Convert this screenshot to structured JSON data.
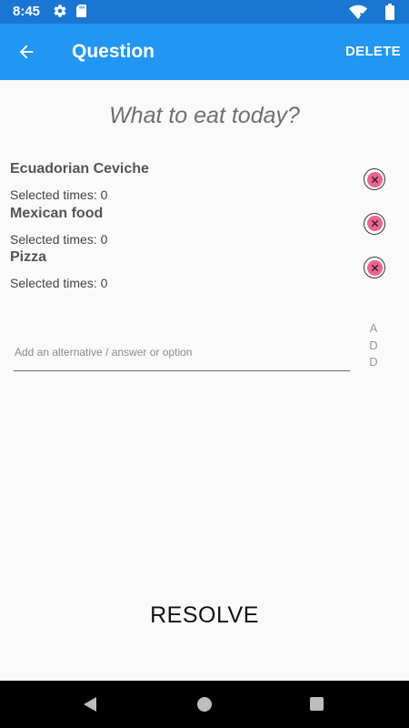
{
  "status_bar": {
    "time": "8:45",
    "icons": [
      "settings-icon",
      "sd-card-icon",
      "wifi-icon",
      "battery-icon"
    ]
  },
  "app_bar": {
    "title": "Question",
    "back_icon": "arrow-back-icon",
    "delete_label": "DELETE",
    "color": "#2196f3"
  },
  "question": {
    "title": "What to eat today?"
  },
  "options": [
    {
      "name": "Ecuadorian Ceviche",
      "selected": "Selected times: 0"
    },
    {
      "name": "Mexican food",
      "selected": "Selected times: 0"
    },
    {
      "name": "Pizza",
      "selected": "Selected times: 0"
    }
  ],
  "add_alternative": {
    "value": "",
    "placeholder": "Add an alternative / answer or option",
    "add_letters": [
      "A",
      "D",
      "D"
    ]
  },
  "resolve_label": "RESOLVE",
  "nav_bar": {
    "icons": [
      "nav-back-icon",
      "nav-home-icon",
      "nav-recents-icon"
    ]
  }
}
